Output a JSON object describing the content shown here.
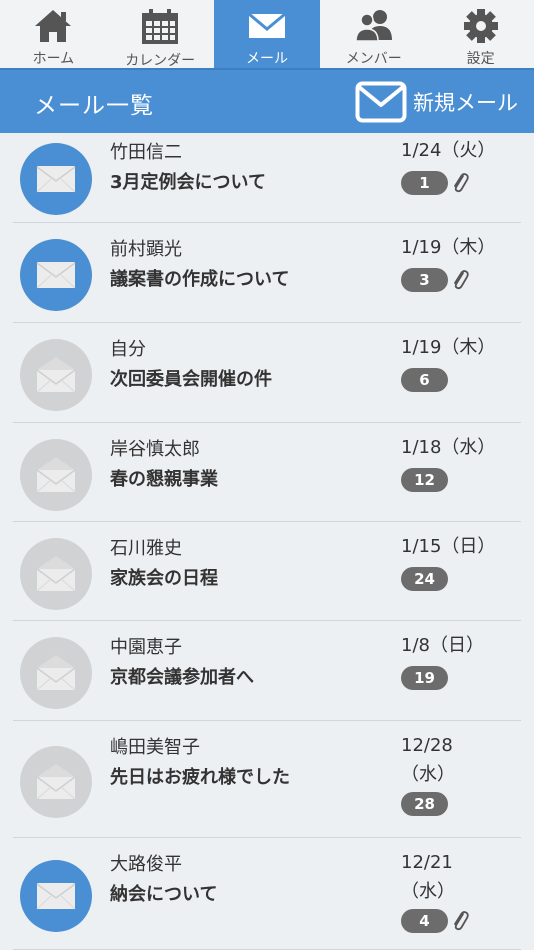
{
  "tabs": [
    {
      "label": "ホーム",
      "icon": "home-icon"
    },
    {
      "label": "カレンダー",
      "icon": "calendar-icon"
    },
    {
      "label": "メール",
      "icon": "mail-icon",
      "active": true
    },
    {
      "label": "メンバー",
      "icon": "members-icon"
    },
    {
      "label": "設定",
      "icon": "gear-icon"
    }
  ],
  "header": {
    "title": "メール一覧",
    "new_mail_label": "新規メール"
  },
  "colors": {
    "accent": "#4a8fd3",
    "badge": "#6c6c6c",
    "read_avatar": "#d0d2d4",
    "background": "#edf0f3"
  },
  "mails": [
    {
      "sender": "竹田信二",
      "subject": "3月定例会について",
      "date_line1": "1/24（火）",
      "date_line2": "",
      "count": "1",
      "attachment": true,
      "unread": true
    },
    {
      "sender": "前村顕光",
      "subject": "議案書の作成について",
      "date_line1": "1/19（木）",
      "date_line2": "",
      "count": "3",
      "attachment": true,
      "unread": true
    },
    {
      "sender": "自分",
      "subject": "次回委員会開催の件",
      "date_line1": "1/19（木）",
      "date_line2": "",
      "count": "6",
      "attachment": false,
      "unread": false
    },
    {
      "sender": "岸谷慎太郎",
      "subject": "春の懇親事業",
      "date_line1": "1/18（水）",
      "date_line2": "",
      "count": "12",
      "attachment": false,
      "unread": false
    },
    {
      "sender": "石川雅史",
      "subject": "家族会の日程",
      "date_line1": "1/15（日）",
      "date_line2": "",
      "count": "24",
      "attachment": false,
      "unread": false
    },
    {
      "sender": "中園恵子",
      "subject": "京都会議参加者へ",
      "date_line1": "1/8（日）",
      "date_line2": "",
      "count": "19",
      "attachment": false,
      "unread": false
    },
    {
      "sender": "嶋田美智子",
      "subject": "先日はお疲れ様でした",
      "date_line1": "12/28",
      "date_line2": "（水）",
      "count": "28",
      "attachment": false,
      "unread": false
    },
    {
      "sender": "大路俊平",
      "subject": "納会について",
      "date_line1": "12/21",
      "date_line2": "（水）",
      "count": "4",
      "attachment": true,
      "unread": true
    }
  ]
}
